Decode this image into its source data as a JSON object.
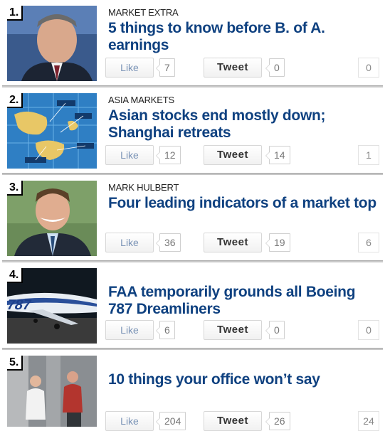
{
  "stories": [
    {
      "rank": "1.",
      "kicker": "MARKET EXTRA",
      "title": "5 things to know before B. of A. earnings",
      "image": "man-portrait-image",
      "like_label": "Like",
      "like_count": "7",
      "tweet_label": "Tweet",
      "tweet_count": "0",
      "share_count": "0"
    },
    {
      "rank": "2.",
      "kicker": "ASIA MARKETS",
      "title": "Asian stocks end mostly down; Shanghai retreats",
      "image": "asia-market-map-image",
      "like_label": "Like",
      "like_count": "12",
      "tweet_label": "Tweet",
      "tweet_count": "14",
      "share_count": "1"
    },
    {
      "rank": "3.",
      "kicker": "MARK HULBERT",
      "title": "Four leading indicators of a market top",
      "image": "mark-hulbert-portrait-image",
      "like_label": "Like",
      "like_count": "36",
      "tweet_label": "Tweet",
      "tweet_count": "19",
      "share_count": "6"
    },
    {
      "rank": "4.",
      "kicker": "",
      "title": "FAA temporarily grounds all Boeing 787 Dreamliners",
      "image": "boeing-787-airplane-image",
      "like_label": "Like",
      "like_count": "6",
      "tweet_label": "Tweet",
      "tweet_count": "0",
      "share_count": "0"
    },
    {
      "rank": "5.",
      "kicker": "",
      "title": "10 things your office won’t say",
      "image": "office-people-image",
      "like_label": "Like",
      "like_count": "204",
      "tweet_label": "Tweet",
      "tweet_count": "26",
      "share_count": "24"
    }
  ],
  "thumb_text": {
    "plane_livery": "787"
  },
  "colors": {
    "title": "#0f4180",
    "like_text": "#7a93b6",
    "divider": "#c8c8c8"
  }
}
